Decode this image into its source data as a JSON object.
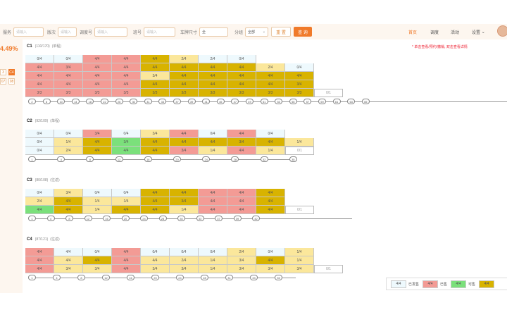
{
  "toolbar": {
    "fields": [
      {
        "label": "服务",
        "placeholder": "请输入"
      },
      {
        "label": "版次",
        "placeholder": "请输入"
      },
      {
        "label": "调度号",
        "placeholder": "请输入"
      },
      {
        "label": "班号",
        "placeholder": "请输入"
      },
      {
        "label": "车牌尺寸",
        "value": "全"
      },
      {
        "label": "分组",
        "value": "全部"
      }
    ],
    "reset_label": "重 置",
    "query_label": "查 询",
    "nav": [
      "首页",
      "调度",
      "活动",
      "设置"
    ]
  },
  "left_rail": {
    "percent": "4.49%",
    "buttons": [
      "3",
      "C4",
      "07",
      "08"
    ]
  },
  "notice": "* 单击查看/预约/撤销, 双击查看详情",
  "sections": [
    {
      "code": "C1",
      "info": "(110/170)",
      "zone": "(单程)",
      "rows": [
        [
          [
            "0/4",
            "w"
          ],
          [
            "0/4",
            "w"
          ],
          [
            "4/4",
            "r"
          ],
          [
            "4/4",
            "r"
          ],
          [
            "4/4",
            "d"
          ],
          [
            "2/4",
            "y"
          ],
          [
            "2/4",
            "w"
          ],
          [
            "0/4",
            "w"
          ]
        ],
        [
          [
            "4/4",
            "r"
          ],
          [
            "3/4",
            "r"
          ],
          [
            "4/4",
            "r"
          ],
          [
            "4/4",
            "r"
          ],
          [
            "4/4",
            "d"
          ],
          [
            "4/4",
            "d"
          ],
          [
            "4/4",
            "d"
          ],
          [
            "4/4",
            "d"
          ],
          [
            "2/4",
            "y"
          ],
          [
            "0/4",
            "w"
          ]
        ],
        [
          [
            "4/4",
            "r"
          ],
          [
            "4/4",
            "r"
          ],
          [
            "4/4",
            "r"
          ],
          [
            "4/4",
            "r"
          ],
          [
            "3/4",
            "y"
          ],
          [
            "4/4",
            "d"
          ],
          [
            "4/4",
            "d"
          ],
          [
            "4/4",
            "d"
          ],
          [
            "4/4",
            "d"
          ],
          [
            "4/4",
            "d"
          ]
        ],
        [
          [
            "4/4",
            "r"
          ],
          [
            "4/4",
            "r"
          ],
          [
            "4/4",
            "r"
          ],
          [
            "4/4",
            "r"
          ],
          [
            "4/4",
            "d"
          ],
          [
            "4/4",
            "d"
          ],
          [
            "4/4",
            "d"
          ],
          [
            "4/4",
            "d"
          ],
          [
            "4/4",
            "d"
          ],
          [
            "3/4",
            "d"
          ]
        ],
        [
          [
            "3/3",
            "r"
          ],
          [
            "3/3",
            "r"
          ],
          [
            "3/3",
            "r"
          ],
          [
            "3/3",
            "r"
          ],
          [
            "3/3",
            "d"
          ],
          [
            "3/3",
            "d"
          ],
          [
            "3/3",
            "d"
          ],
          [
            "3/3",
            "d"
          ],
          [
            "3/3",
            "d"
          ],
          [
            "3/3",
            "d"
          ],
          [
            "0/1",
            "e"
          ]
        ]
      ],
      "axis": [
        "2",
        "6",
        "10",
        "14",
        "18",
        "22",
        "26",
        "30",
        "31",
        "33",
        "37",
        "39",
        "41",
        "45",
        "47",
        "49",
        "51",
        "53",
        "55",
        "57",
        "59",
        "61",
        "63",
        "65"
      ]
    },
    {
      "code": "C2",
      "info": "(92/109)",
      "zone": "(单程)",
      "rows": [
        [
          [
            "0/4",
            "w"
          ],
          [
            "0/4",
            "w"
          ],
          [
            "3/4",
            "r"
          ],
          [
            "0/4",
            "w"
          ],
          [
            "3/4",
            "y"
          ],
          [
            "4/4",
            "r"
          ],
          [
            "0/4",
            "w"
          ],
          [
            "4/4",
            "r"
          ],
          [
            "0/4",
            "w"
          ]
        ],
        [
          [
            "0/4",
            "w"
          ],
          [
            "1/4",
            "y"
          ],
          [
            "4/4",
            "d"
          ],
          [
            "3/4",
            "g"
          ],
          [
            "4/4",
            "d"
          ],
          [
            "4/4",
            "d"
          ],
          [
            "4/4",
            "d"
          ],
          [
            "3/4",
            "d"
          ],
          [
            "4/4",
            "d"
          ],
          [
            "1/4",
            "y"
          ]
        ],
        [
          [
            "0/4",
            "w"
          ],
          [
            "2/4",
            "y"
          ],
          [
            "4/4",
            "d"
          ],
          [
            "4/4",
            "g"
          ],
          [
            "4/4",
            "d"
          ],
          [
            "3/4",
            "r"
          ],
          [
            "1/4",
            "y"
          ],
          [
            "4/4",
            "r"
          ],
          [
            "1/4",
            "y"
          ],
          [
            "0/1",
            "e"
          ]
        ]
      ],
      "axis": [
        "1",
        "4",
        "8",
        "12",
        "16",
        "20",
        "24",
        "28",
        "32",
        "35"
      ]
    },
    {
      "code": "C3",
      "info": "(80/108)",
      "zone": "(往返)",
      "rows": [
        [
          [
            "0/4",
            "w"
          ],
          [
            "3/4",
            "y"
          ],
          [
            "0/4",
            "w"
          ],
          [
            "0/4",
            "w"
          ],
          [
            "4/4",
            "d"
          ],
          [
            "4/4",
            "d"
          ],
          [
            "4/4",
            "r"
          ],
          [
            "4/4",
            "r"
          ],
          [
            "4/4",
            "d"
          ]
        ],
        [
          [
            "2/4",
            "y"
          ],
          [
            "4/4",
            "d"
          ],
          [
            "1/4",
            "y"
          ],
          [
            "1/4",
            "y"
          ],
          [
            "4/4",
            "d"
          ],
          [
            "3/4",
            "d"
          ],
          [
            "4/4",
            "r"
          ],
          [
            "4/4",
            "r"
          ],
          [
            "4/4",
            "d"
          ]
        ],
        [
          [
            "4/4",
            "g"
          ],
          [
            "4/4",
            "d"
          ],
          [
            "1/4",
            "y"
          ],
          [
            "4/4",
            "d"
          ],
          [
            "4/4",
            "d"
          ],
          [
            "1/4",
            "y"
          ],
          [
            "4/4",
            "r"
          ],
          [
            "4/4",
            "r"
          ],
          [
            "4/4",
            "d"
          ],
          [
            "0/1",
            "e"
          ]
        ]
      ],
      "axis": [
        "1",
        "4",
        "8",
        "12",
        "16",
        "20",
        "24",
        "28",
        "30",
        "33",
        "37",
        "39",
        "42"
      ]
    },
    {
      "code": "C4",
      "info": "(87/121)",
      "zone": "(往返)",
      "rows": [
        [
          [
            "4/4",
            "r"
          ],
          [
            "4/4",
            "w"
          ],
          [
            "0/4",
            "w"
          ],
          [
            "4/4",
            "r"
          ],
          [
            "0/4",
            "w"
          ],
          [
            "0/4",
            "w"
          ],
          [
            "0/4",
            "w"
          ],
          [
            "2/4",
            "y"
          ],
          [
            "0/4",
            "w"
          ],
          [
            "1/4",
            "y"
          ]
        ],
        [
          [
            "4/4",
            "r"
          ],
          [
            "4/4",
            "y"
          ],
          [
            "4/4",
            "d"
          ],
          [
            "4/4",
            "r"
          ],
          [
            "4/4",
            "y"
          ],
          [
            "2/4",
            "y"
          ],
          [
            "1/4",
            "y"
          ],
          [
            "3/4",
            "y"
          ],
          [
            "4/4",
            "d"
          ],
          [
            "1/4",
            "y"
          ]
        ],
        [
          [
            "4/4",
            "r"
          ],
          [
            "3/4",
            "y"
          ],
          [
            "3/4",
            "y"
          ],
          [
            "4/4",
            "r"
          ],
          [
            "3/4",
            "y"
          ],
          [
            "3/4",
            "y"
          ],
          [
            "1/4",
            "y"
          ],
          [
            "3/4",
            "y"
          ],
          [
            "3/4",
            "y"
          ],
          [
            "3/4",
            "y"
          ],
          [
            "0/1",
            "e"
          ]
        ]
      ],
      "axis": [
        "1",
        "4",
        "8",
        "12",
        "16",
        "20",
        "24",
        "28",
        "31",
        "33",
        "35"
      ]
    }
  ],
  "legend": [
    {
      "text": "4/4",
      "label": "已发售",
      "color": "w"
    },
    {
      "text": "4/4",
      "label": "已售",
      "color": "r"
    },
    {
      "text": "4/4",
      "label": "可售",
      "color": "g"
    },
    {
      "text": "4/4",
      "label": "",
      "color": "d"
    }
  ]
}
